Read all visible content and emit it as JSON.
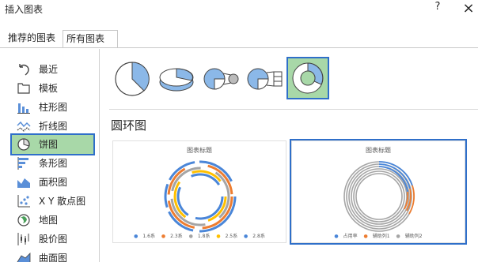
{
  "dialog": {
    "title": "插入图表",
    "help": "?",
    "close": "×"
  },
  "tabs": [
    {
      "label": "推荐的图表",
      "selected": false
    },
    {
      "label": "所有图表",
      "selected": true
    }
  ],
  "sidebar": {
    "items": [
      {
        "label": "最近",
        "icon": "undo-icon"
      },
      {
        "label": "模板",
        "icon": "template-icon"
      },
      {
        "label": "柱形图",
        "icon": "column-chart-icon"
      },
      {
        "label": "折线图",
        "icon": "line-chart-icon"
      },
      {
        "label": "饼图",
        "icon": "pie-chart-icon",
        "selected": true
      },
      {
        "label": "条形图",
        "icon": "bar-chart-icon"
      },
      {
        "label": "面积图",
        "icon": "area-chart-icon"
      },
      {
        "label": "X Y 散点图",
        "icon": "scatter-chart-icon"
      },
      {
        "label": "地图",
        "icon": "map-icon"
      },
      {
        "label": "股价图",
        "icon": "stock-chart-icon"
      },
      {
        "label": "曲面图",
        "icon": "surface-chart-icon"
      }
    ]
  },
  "subtypes": [
    {
      "icon": "pie-icon"
    },
    {
      "icon": "3d-pie-icon"
    },
    {
      "icon": "pie-of-pie-icon"
    },
    {
      "icon": "bar-of-pie-icon"
    },
    {
      "icon": "doughnut-icon",
      "selected": true
    }
  ],
  "section": {
    "title": "圆环图"
  },
  "previews": [
    {
      "title": "图表标题",
      "legend": [
        "1.6系",
        "2.3系",
        "1.8系",
        "2.5系",
        "2.8系"
      ],
      "selected": false
    },
    {
      "title": "图表标题",
      "legend": [
        "占用率",
        "辅助列1",
        "辅助列2"
      ],
      "selected": true
    }
  ],
  "colors": {
    "accent_blue": "#2f6fc9",
    "selected_green": "#a8d8a8",
    "chart_blue": "#4a86d8",
    "chart_orange": "#ed7d31",
    "chart_gray": "#a5a5a5",
    "chart_yellow": "#ffc000"
  }
}
